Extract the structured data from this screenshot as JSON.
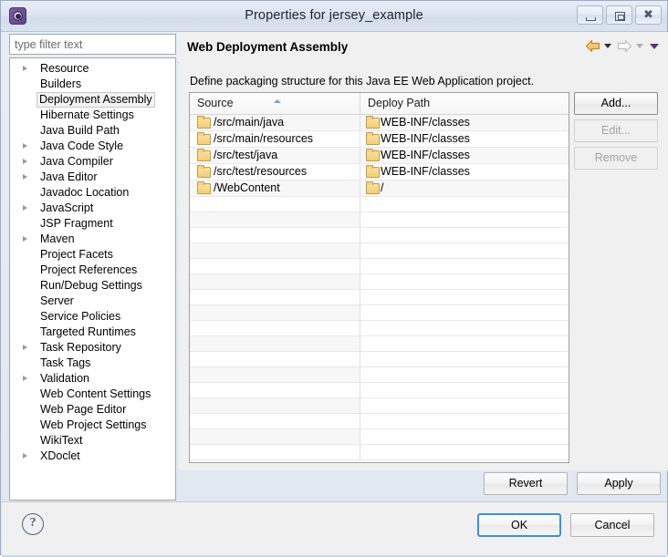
{
  "window": {
    "title": "Properties for jersey_example",
    "app_icon": "eclipse-icon",
    "controls": {
      "minimize": "minimize-icon",
      "maximize": "maximize-icon",
      "close": "close-icon"
    }
  },
  "sidebar": {
    "filter": {
      "value": "",
      "placeholder": "type filter text"
    },
    "items": [
      {
        "label": "Resource",
        "expandable": true,
        "selected": false
      },
      {
        "label": "Builders",
        "expandable": false,
        "selected": false
      },
      {
        "label": "Deployment Assembly",
        "expandable": false,
        "selected": true
      },
      {
        "label": "Hibernate Settings",
        "expandable": false,
        "selected": false
      },
      {
        "label": "Java Build Path",
        "expandable": false,
        "selected": false
      },
      {
        "label": "Java Code Style",
        "expandable": true,
        "selected": false
      },
      {
        "label": "Java Compiler",
        "expandable": true,
        "selected": false
      },
      {
        "label": "Java Editor",
        "expandable": true,
        "selected": false
      },
      {
        "label": "Javadoc Location",
        "expandable": false,
        "selected": false
      },
      {
        "label": "JavaScript",
        "expandable": true,
        "selected": false
      },
      {
        "label": "JSP Fragment",
        "expandable": false,
        "selected": false
      },
      {
        "label": "Maven",
        "expandable": true,
        "selected": false
      },
      {
        "label": "Project Facets",
        "expandable": false,
        "selected": false
      },
      {
        "label": "Project References",
        "expandable": false,
        "selected": false
      },
      {
        "label": "Run/Debug Settings",
        "expandable": false,
        "selected": false
      },
      {
        "label": "Server",
        "expandable": false,
        "selected": false
      },
      {
        "label": "Service Policies",
        "expandable": false,
        "selected": false
      },
      {
        "label": "Targeted Runtimes",
        "expandable": false,
        "selected": false
      },
      {
        "label": "Task Repository",
        "expandable": true,
        "selected": false
      },
      {
        "label": "Task Tags",
        "expandable": false,
        "selected": false
      },
      {
        "label": "Validation",
        "expandable": true,
        "selected": false
      },
      {
        "label": "Web Content Settings",
        "expandable": false,
        "selected": false
      },
      {
        "label": "Web Page Editor",
        "expandable": false,
        "selected": false
      },
      {
        "label": "Web Project Settings",
        "expandable": false,
        "selected": false
      },
      {
        "label": "WikiText",
        "expandable": false,
        "selected": false
      },
      {
        "label": "XDoclet",
        "expandable": true,
        "selected": false
      }
    ]
  },
  "panel": {
    "title": "Web Deployment Assembly",
    "description": "Define packaging structure for this Java EE Web Application project.",
    "nav": {
      "back": "back-arrow-icon",
      "back_menu": "back-dropdown-icon",
      "forward": "forward-arrow-icon",
      "forward_menu": "forward-dropdown-icon",
      "menu": "view-menu-icon"
    }
  },
  "table": {
    "columns": [
      "Source",
      "Deploy Path"
    ],
    "sort_column": "Source",
    "sort_direction": "ascending",
    "rows": [
      {
        "source": "/src/main/java",
        "deploy": "WEB-INF/classes"
      },
      {
        "source": "/src/main/resources",
        "deploy": "WEB-INF/classes"
      },
      {
        "source": "/src/test/java",
        "deploy": "WEB-INF/classes"
      },
      {
        "source": "/src/test/resources",
        "deploy": "WEB-INF/classes"
      },
      {
        "source": "/WebContent",
        "deploy": "/"
      }
    ],
    "empty_row_count": 17
  },
  "side_buttons": [
    {
      "label": "Add...",
      "enabled": true
    },
    {
      "label": "Edit...",
      "enabled": false
    },
    {
      "label": "Remove",
      "enabled": false
    }
  ],
  "apply_buttons": [
    {
      "label": "Revert"
    },
    {
      "label": "Apply"
    }
  ],
  "footer": {
    "help": "help-icon",
    "ok": "OK",
    "cancel": "Cancel"
  },
  "colors": {
    "accent": "#3c92d8",
    "folder": "#f3cd79",
    "back_arrow": "#e8a33d",
    "menu_caret": "#5b2d82"
  }
}
